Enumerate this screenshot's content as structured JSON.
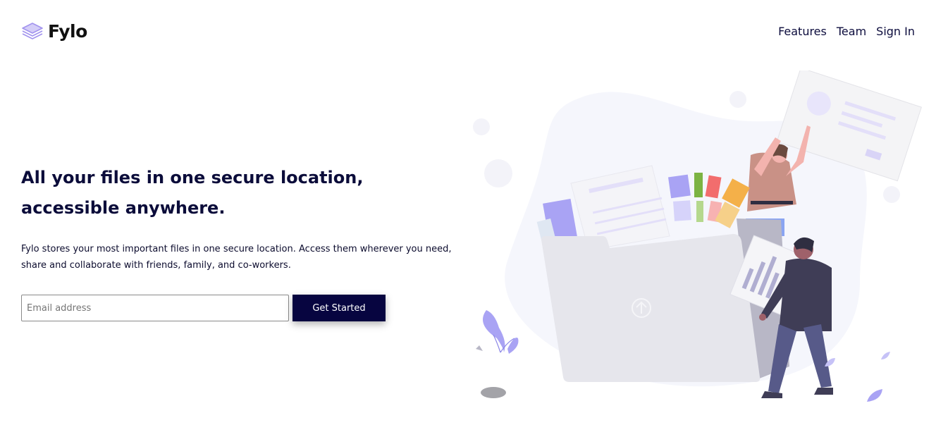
{
  "brand": {
    "name": "Fylo",
    "icon": "stacked-layers-icon",
    "accent_color": "#a294ee"
  },
  "nav": {
    "items": [
      {
        "label": "Features"
      },
      {
        "label": "Team"
      },
      {
        "label": "Sign In"
      }
    ]
  },
  "hero": {
    "title": "All your files in one secure location, accessible anywhere.",
    "text": "Fylo stores your most important files in one secure location. Access them wherever you need, share and collaborate with friends, family, and co-workers."
  },
  "signup": {
    "email_placeholder": "Email address",
    "email_value": "",
    "button_label": "Get Started",
    "button_color": "#070540"
  },
  "illustration": {
    "icon": "upload-arrow-icon",
    "description_icon": "people-uploading-files-illustration"
  }
}
